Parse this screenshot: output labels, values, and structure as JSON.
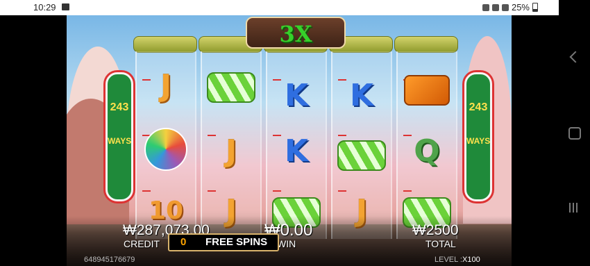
{
  "status_bar": {
    "time": "10:29",
    "battery": "25%"
  },
  "multiplier": "3X",
  "ways": {
    "left": [
      "243",
      "WAYS"
    ],
    "right": [
      "243",
      "WAYS"
    ]
  },
  "reels": [
    {
      "symbols": [
        "J",
        "lollipop",
        "10"
      ]
    },
    {
      "symbols": [
        "green-candy",
        "J",
        "J"
      ]
    },
    {
      "symbols": [
        "K",
        "K",
        "green-candy"
      ]
    },
    {
      "symbols": [
        "K",
        "green-candy",
        "J"
      ]
    },
    {
      "symbols": [
        "orange-candy",
        "Q",
        "green-candy"
      ]
    }
  ],
  "meters": {
    "credit_value": "₩287,073.00",
    "credit_label": "CREDIT",
    "win_value": "₩0.00",
    "win_label": "WIN",
    "total_value": "₩2500",
    "total_label": "TOTAL"
  },
  "free_spins": {
    "count": "0",
    "label": "FREE SPINS"
  },
  "footer": {
    "session_id": "648945176679",
    "level_label": "LEVEL :",
    "level_value": "X100"
  }
}
